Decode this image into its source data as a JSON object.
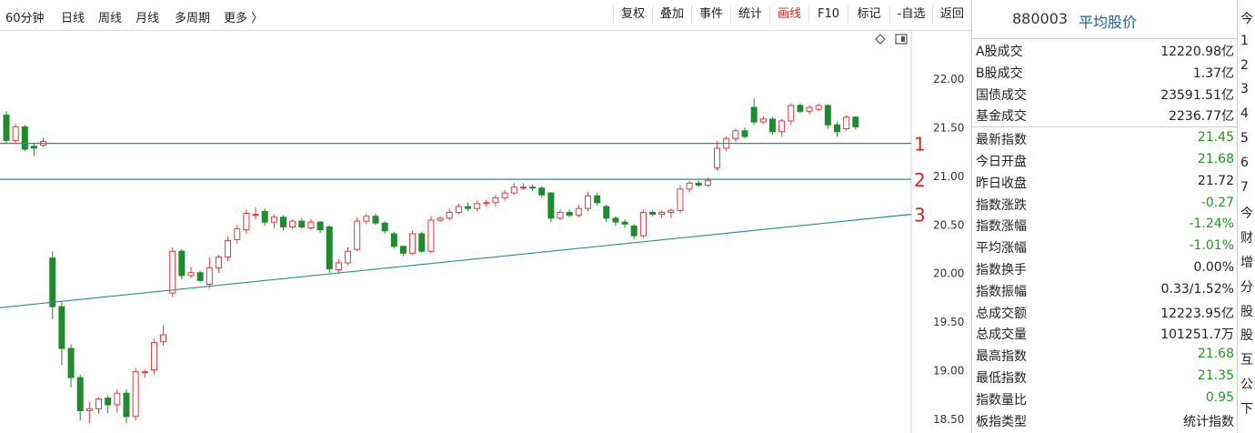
{
  "toolbar": {
    "periods": [
      {
        "label": "60分钟",
        "active": true
      },
      {
        "label": "日线",
        "active": false
      },
      {
        "label": "周线",
        "active": false
      },
      {
        "label": "月线",
        "active": false
      },
      {
        "label": "多周期",
        "active": false
      },
      {
        "label": "更多 〉",
        "active": false
      }
    ],
    "buttons": [
      {
        "label": "复权",
        "color": "normal"
      },
      {
        "label": "叠加",
        "color": "normal"
      },
      {
        "label": "事件",
        "color": "normal"
      },
      {
        "label": "统计",
        "color": "normal"
      },
      {
        "label": "画线",
        "color": "red"
      },
      {
        "label": "F10",
        "color": "normal"
      },
      {
        "label": "标记",
        "color": "normal"
      },
      {
        "label": "-自选",
        "color": "normal"
      },
      {
        "label": "返回",
        "color": "normal"
      }
    ]
  },
  "chart": {
    "icons": [
      "diamond-icon",
      "window-restore-icon"
    ],
    "colors": {
      "up": "#e8353b",
      "down": "#1e8c2d",
      "line": "#2a8f8f"
    },
    "price_ticks": [
      "22.00",
      "21.50",
      "21.00",
      "20.50",
      "20.00",
      "19.50",
      "19.00",
      "18.50"
    ],
    "line_labels": [
      "1",
      "2",
      "3"
    ]
  },
  "chart_data": {
    "type": "candlestick",
    "ylim": [
      18.4,
      22.4
    ],
    "yticks": [
      22.0,
      21.5,
      21.0,
      20.5,
      20.0,
      19.5,
      19.0,
      18.5
    ],
    "candles": [
      [
        21.62,
        21.36,
        21.66,
        21.33
      ],
      [
        21.36,
        21.5,
        21.53,
        21.32
      ],
      [
        21.5,
        21.27,
        21.52,
        21.25
      ],
      [
        21.3,
        21.28,
        21.33,
        21.2
      ],
      [
        21.31,
        21.35,
        21.39,
        21.29
      ],
      [
        20.15,
        19.65,
        20.22,
        19.52
      ],
      [
        19.65,
        19.22,
        19.7,
        19.05
      ],
      [
        19.22,
        18.92,
        19.26,
        18.82
      ],
      [
        18.92,
        18.58,
        18.95,
        18.48
      ],
      [
        18.58,
        18.6,
        18.67,
        18.45
      ],
      [
        18.6,
        18.7,
        18.72,
        18.55
      ],
      [
        18.71,
        18.64,
        18.74,
        18.55
      ],
      [
        18.64,
        18.76,
        18.8,
        18.56
      ],
      [
        18.76,
        18.52,
        18.8,
        18.45
      ],
      [
        18.52,
        18.98,
        19.02,
        18.48
      ],
      [
        18.98,
        18.98,
        19.0,
        18.92
      ],
      [
        19.0,
        19.28,
        19.32,
        18.95
      ],
      [
        19.29,
        19.36,
        19.46,
        19.25
      ],
      [
        19.79,
        20.22,
        20.26,
        19.75
      ],
      [
        20.22,
        19.97,
        20.24,
        19.93
      ],
      [
        19.97,
        20.0,
        20.06,
        19.94
      ],
      [
        20.0,
        19.92,
        20.02,
        19.9
      ],
      [
        19.88,
        20.05,
        20.16,
        19.84
      ],
      [
        20.05,
        20.16,
        20.18,
        20.0
      ],
      [
        20.16,
        20.33,
        20.37,
        20.12
      ],
      [
        20.34,
        20.45,
        20.49,
        20.3
      ],
      [
        20.44,
        20.61,
        20.65,
        20.4
      ],
      [
        20.6,
        20.6,
        20.67,
        20.55
      ],
      [
        20.63,
        20.52,
        20.66,
        20.48
      ],
      [
        20.52,
        20.57,
        20.6,
        20.46
      ],
      [
        20.57,
        20.47,
        20.59,
        20.43
      ],
      [
        20.47,
        20.53,
        20.55,
        20.44
      ],
      [
        20.53,
        20.47,
        20.56,
        20.45
      ],
      [
        20.46,
        20.52,
        20.55,
        20.44
      ],
      [
        20.52,
        20.44,
        20.53,
        20.41
      ],
      [
        20.47,
        20.04,
        20.49,
        20.0
      ],
      [
        20.03,
        20.1,
        20.14,
        20.0
      ],
      [
        20.1,
        20.22,
        20.26,
        20.08
      ],
      [
        20.24,
        20.53,
        20.57,
        20.22
      ],
      [
        20.53,
        20.58,
        20.61,
        20.5
      ],
      [
        20.58,
        20.51,
        20.61,
        20.49
      ],
      [
        20.51,
        20.43,
        20.53,
        20.4
      ],
      [
        20.4,
        20.27,
        20.42,
        20.25
      ],
      [
        20.27,
        20.2,
        20.28,
        20.17
      ],
      [
        20.2,
        20.4,
        20.43,
        20.18
      ],
      [
        20.4,
        20.22,
        20.42,
        20.2
      ],
      [
        20.22,
        20.54,
        20.58,
        20.2
      ],
      [
        20.54,
        20.56,
        20.58,
        20.52
      ],
      [
        20.56,
        20.62,
        20.66,
        20.54
      ],
      [
        20.62,
        20.68,
        20.71,
        20.6
      ],
      [
        20.68,
        20.66,
        20.72,
        20.63
      ],
      [
        20.66,
        20.71,
        20.74,
        20.63
      ],
      [
        20.71,
        20.72,
        20.75,
        20.68
      ],
      [
        20.72,
        20.77,
        20.8,
        20.68
      ],
      [
        20.77,
        20.82,
        20.85,
        20.74
      ],
      [
        20.82,
        20.88,
        20.92,
        20.8
      ],
      [
        20.88,
        20.88,
        20.92,
        20.85
      ],
      [
        20.88,
        20.87,
        20.91,
        20.84
      ],
      [
        20.87,
        20.8,
        20.89,
        20.77
      ],
      [
        20.82,
        20.56,
        20.83,
        20.52
      ],
      [
        20.56,
        20.62,
        20.65,
        20.54
      ],
      [
        20.62,
        20.59,
        20.65,
        20.57
      ],
      [
        20.59,
        20.66,
        20.7,
        20.57
      ],
      [
        20.66,
        20.79,
        20.83,
        20.63
      ],
      [
        20.79,
        20.72,
        20.82,
        20.69
      ],
      [
        20.68,
        20.56,
        20.7,
        20.52
      ],
      [
        20.56,
        20.52,
        20.58,
        20.48
      ],
      [
        20.52,
        20.5,
        20.55,
        20.46
      ],
      [
        20.48,
        20.38,
        20.5,
        20.34
      ],
      [
        20.38,
        20.62,
        20.65,
        20.35
      ],
      [
        20.62,
        20.6,
        20.64,
        20.58
      ],
      [
        20.6,
        20.62,
        20.64,
        20.56
      ],
      [
        20.62,
        20.64,
        20.66,
        20.56
      ],
      [
        20.64,
        20.86,
        20.9,
        20.61
      ],
      [
        20.86,
        20.92,
        20.94,
        20.83
      ],
      [
        20.92,
        20.9,
        20.95,
        20.88
      ],
      [
        20.9,
        20.95,
        20.98,
        20.88
      ],
      [
        21.08,
        21.28,
        21.35,
        21.05
      ],
      [
        21.28,
        21.38,
        21.4,
        21.25
      ],
      [
        21.38,
        21.46,
        21.48,
        21.35
      ],
      [
        21.46,
        21.4,
        21.49,
        21.38
      ],
      [
        21.7,
        21.55,
        21.79,
        21.52
      ],
      [
        21.55,
        21.58,
        21.61,
        21.53
      ],
      [
        21.58,
        21.45,
        21.6,
        21.42
      ],
      [
        21.45,
        21.56,
        21.58,
        21.4
      ],
      [
        21.56,
        21.72,
        21.74,
        21.52
      ],
      [
        21.72,
        21.66,
        21.74,
        21.64
      ],
      [
        21.66,
        21.7,
        21.72,
        21.63
      ],
      [
        21.68,
        21.72,
        21.74,
        21.66
      ],
      [
        21.72,
        21.52,
        21.73,
        21.48
      ],
      [
        21.52,
        21.45,
        21.55,
        21.4
      ],
      [
        21.48,
        21.6,
        21.62,
        21.46
      ],
      [
        21.6,
        21.5,
        21.61,
        21.47
      ]
    ],
    "lines": [
      {
        "label": "1",
        "y_start": 21.33,
        "y_end": 21.33
      },
      {
        "label": "2",
        "y_start": 20.96,
        "y_end": 20.96
      },
      {
        "label": "3",
        "y_start": 19.64,
        "y_end": 20.6
      }
    ]
  },
  "panel": {
    "code": "880003",
    "name": "平均股价",
    "rows_top": [
      {
        "label": "A股成交",
        "value": "12220.98亿",
        "color": "normal"
      },
      {
        "label": "B股成交",
        "value": "1.37亿",
        "color": "normal"
      },
      {
        "label": "国债成交",
        "value": "23591.51亿",
        "color": "normal"
      },
      {
        "label": "基金成交",
        "value": "2236.77亿",
        "color": "normal"
      }
    ],
    "rows_bottom": [
      {
        "label": "最新指数",
        "value": "21.45",
        "color": "green"
      },
      {
        "label": "今日开盘",
        "value": "21.68",
        "color": "green"
      },
      {
        "label": "昨日收盘",
        "value": "21.72",
        "color": "normal"
      },
      {
        "label": "指数涨跌",
        "value": "-0.27",
        "color": "green"
      },
      {
        "label": "指数涨幅",
        "value": "-1.24%",
        "color": "green"
      },
      {
        "label": "平均涨幅",
        "value": "-1.01%",
        "color": "green"
      },
      {
        "label": "指数换手",
        "value": "0.00%",
        "color": "normal"
      },
      {
        "label": "指数振幅",
        "value": "0.33/1.52%",
        "color": "normal"
      },
      {
        "label": "总成交额",
        "value": "12223.95亿",
        "color": "normal"
      },
      {
        "label": "总成交量",
        "value": "101251.7万",
        "color": "normal"
      },
      {
        "label": "最高指数",
        "value": "21.68",
        "color": "green"
      },
      {
        "label": "最低指数",
        "value": "21.35",
        "color": "green"
      },
      {
        "label": "指数量比",
        "value": "0.95",
        "color": "green"
      },
      {
        "label": "板指类型",
        "value": "统计指数",
        "color": "normal"
      }
    ]
  },
  "edge": [
    "今",
    "1",
    "2",
    "3",
    "4",
    "5",
    "6",
    "7",
    "今",
    "财",
    "增",
    "分",
    "股",
    "股",
    "互",
    "公",
    "下"
  ]
}
